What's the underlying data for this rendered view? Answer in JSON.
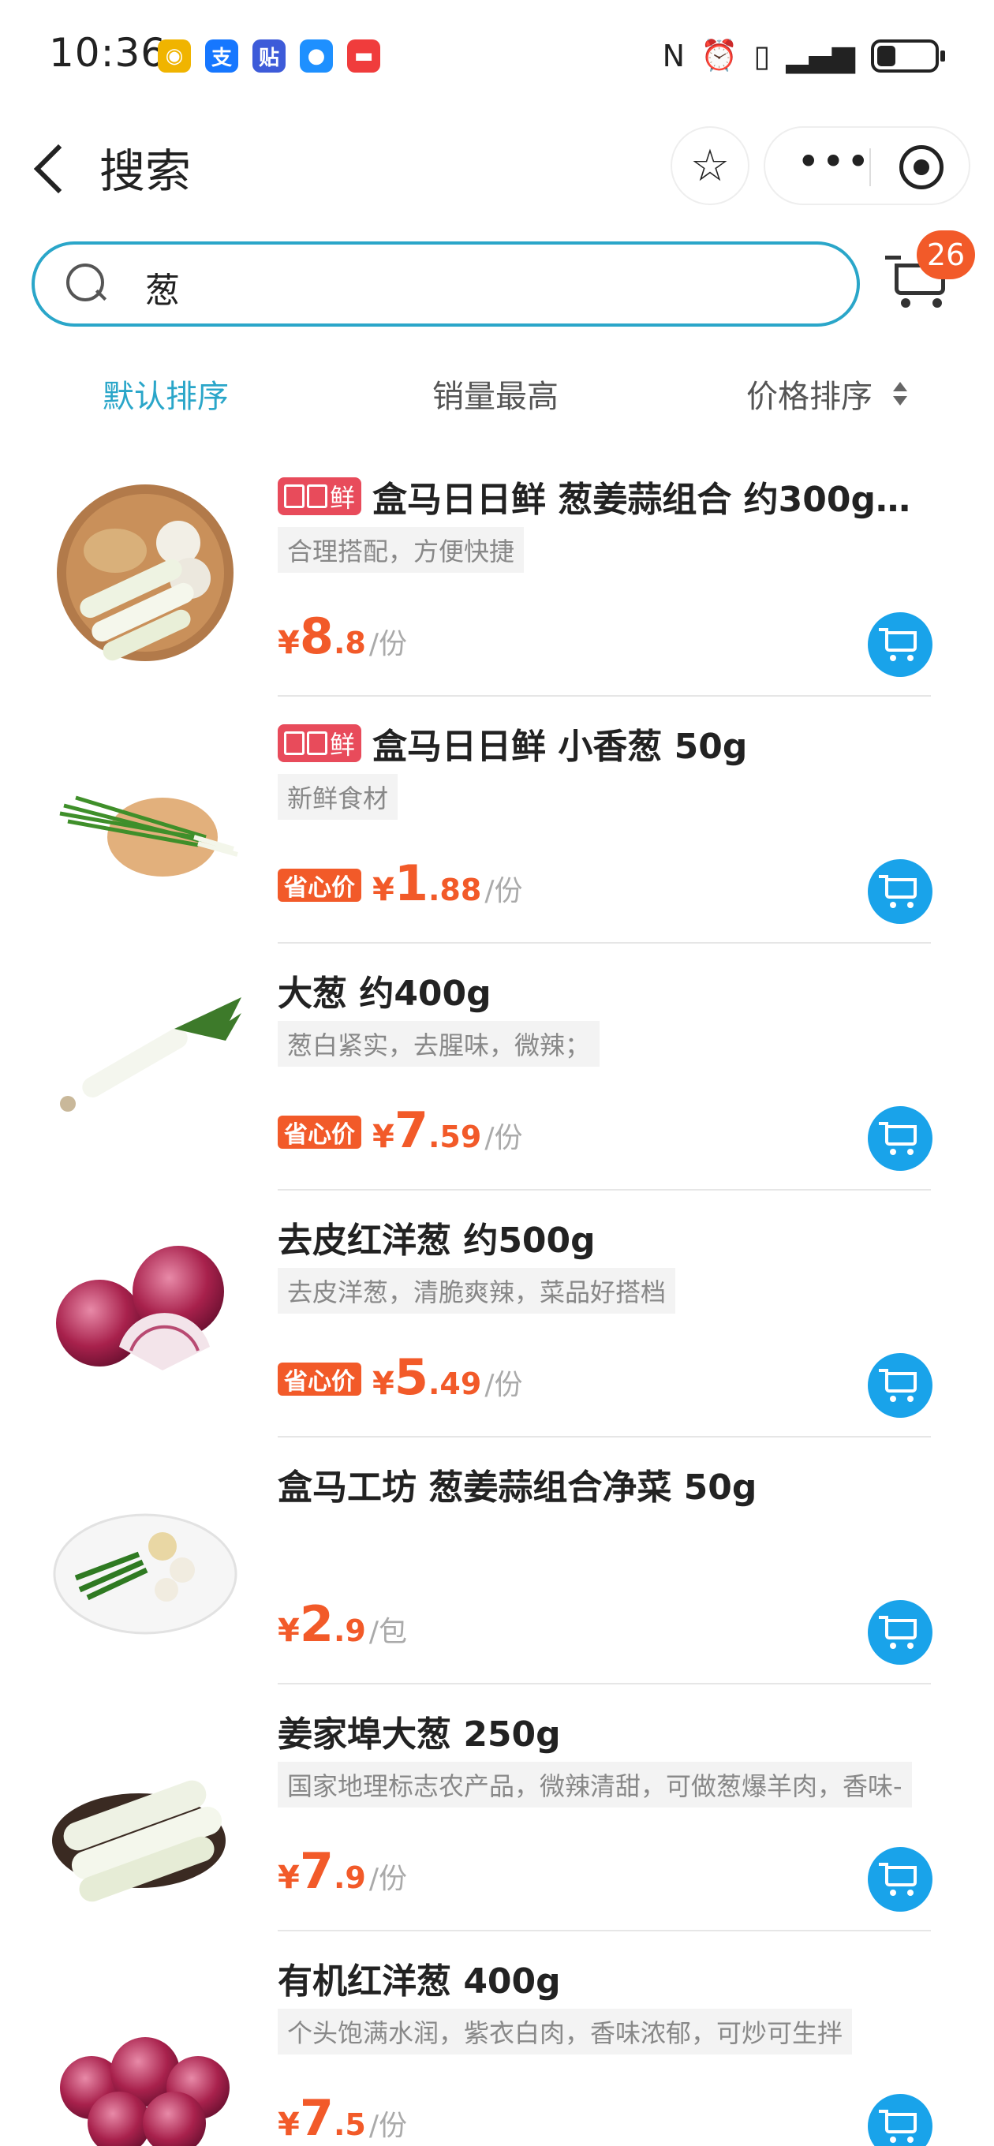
{
  "status_bar": {
    "time": "10:36",
    "apps": [
      {
        "icon": "weibo-icon",
        "glyph": "◉",
        "color": "#f0b400"
      },
      {
        "icon": "alipay-icon",
        "glyph": "支",
        "color": "#1677ff"
      },
      {
        "icon": "tieba-icon",
        "glyph": "贴",
        "color": "#3d5bd9"
      },
      {
        "icon": "message-icon",
        "glyph": "●",
        "color": "#1e90ff"
      },
      {
        "icon": "mail-icon",
        "glyph": "▬",
        "color": "#f03c3c"
      }
    ]
  },
  "nav": {
    "title": "搜索"
  },
  "search": {
    "query": "葱"
  },
  "cart": {
    "count": "26"
  },
  "sort_tabs": [
    "默认排序",
    "销量最高",
    "价格排序"
  ],
  "products": [
    {
      "has_brand": true,
      "brand": "鲜",
      "title": "盒马日日鲜 葱姜蒜组合 约300g…",
      "subtitle": "合理搭配，方便快捷",
      "promo": "",
      "yen": "¥",
      "price_int": "8",
      "price_dec": ".8",
      "unit": "/份",
      "thumb": "ginger-garlic-scallion"
    },
    {
      "has_brand": true,
      "brand": "鲜",
      "title": "盒马日日鲜 小香葱 50g",
      "subtitle": "新鲜食材",
      "promo": "省心价",
      "yen": "¥",
      "price_int": "1",
      "price_dec": ".88",
      "unit": "/份",
      "thumb": "green-onion"
    },
    {
      "has_brand": false,
      "brand": "",
      "title": "大葱 约400g",
      "subtitle": "葱白紧实，去腥味，微辣；",
      "promo": "省心价",
      "yen": "¥",
      "price_int": "7",
      "price_dec": ".59",
      "unit": "/份",
      "thumb": "leek"
    },
    {
      "has_brand": false,
      "brand": "",
      "title": "去皮红洋葱 约500g",
      "subtitle": "去皮洋葱，清脆爽辣，菜品好搭档",
      "promo": "省心价",
      "yen": "¥",
      "price_int": "5",
      "price_dec": ".49",
      "unit": "/份",
      "thumb": "red-onion"
    },
    {
      "has_brand": false,
      "brand": "",
      "title": "盒马工坊 葱姜蒜组合净菜 50g",
      "subtitle": "",
      "promo": "",
      "yen": "¥",
      "price_int": "2",
      "price_dec": ".9",
      "unit": "/包",
      "thumb": "plate-combo"
    },
    {
      "has_brand": false,
      "brand": "",
      "title": "姜家埠大葱 250g",
      "subtitle": "国家地理标志农产品，微辣清甜，可做葱爆羊肉，香味-",
      "promo": "",
      "yen": "¥",
      "price_int": "7",
      "price_dec": ".9",
      "unit": "/份",
      "thumb": "leek-stalks"
    },
    {
      "has_brand": false,
      "brand": "",
      "title": "有机红洋葱 400g",
      "subtitle": "个头饱满水润，紫衣白肉，香味浓郁，可炒可生拌",
      "promo": "",
      "yen": "¥",
      "price_int": "7",
      "price_dec": ".5",
      "unit": "/份",
      "thumb": "red-onions-pile"
    }
  ],
  "colors": {
    "accent": "#2aa6c9",
    "price": "#f25a29",
    "cart_button": "#19a3ea",
    "brand_tag": "#e84b5b"
  }
}
